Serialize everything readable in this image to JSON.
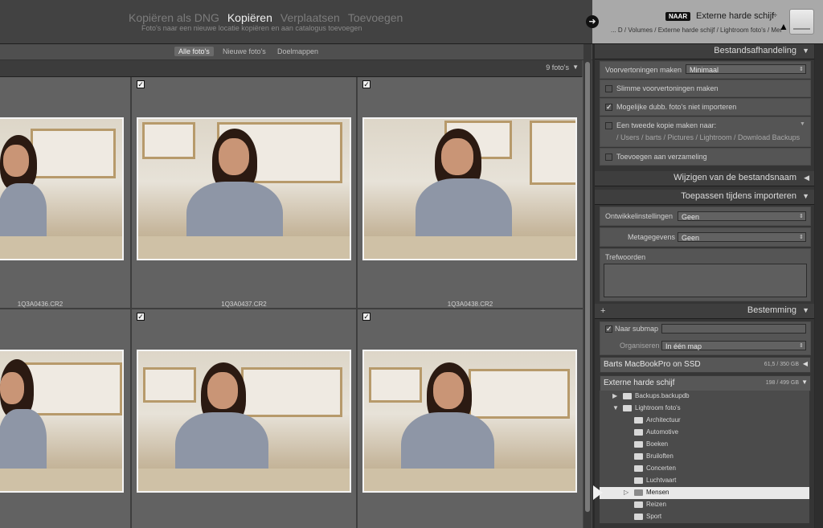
{
  "header": {
    "modes": [
      "Kopiëren als DNG",
      "Kopiëren",
      "Verplaatsen",
      "Toevoegen"
    ],
    "active_mode": "Kopiëren",
    "mode_description": "Foto's naar een nieuwe locatie kopiëren en aan catalogus toevoegen",
    "arrow_icon": "arrow-right-icon",
    "destination": {
      "badge": "NAAR",
      "name": "Externe harde schijf",
      "chevron": "÷",
      "path": "... D / Volumes / Externe harde schijf / Lightroom foto's / Mensen"
    }
  },
  "filters": [
    "Alle foto's",
    "Nieuwe foto's",
    "Doelmappen"
  ],
  "grid": {
    "count_label": "9 foto's",
    "count_tri": "▼",
    "photos": [
      {
        "filename": "1Q3A0436.CR2",
        "checked": true
      },
      {
        "filename": "1Q3A0437.CR2",
        "checked": true
      },
      {
        "filename": "1Q3A0438.CR2",
        "checked": true
      },
      {
        "filename": "",
        "checked": true
      },
      {
        "filename": "",
        "checked": true
      },
      {
        "filename": "",
        "checked": true
      }
    ]
  },
  "panel": {
    "file_handling": {
      "title": "Bestandsafhandeling",
      "preview_label": "Voorvertoningen maken",
      "preview_value": "Minimaal",
      "smart_previews": "Slimme voorvertoningen maken",
      "no_duplicates": "Mogelijke dubb. foto's niet importeren",
      "second_copy": "Een tweede kopie maken naar:",
      "second_copy_path": "/ Users / barts / Pictures / Lightroom / Download Backups",
      "add_collection": "Toevoegen aan verzameling"
    },
    "rename": {
      "title": "Wijzigen van de bestandsnaam"
    },
    "apply": {
      "title": "Toepassen tijdens importeren",
      "develop_label": "Ontwikkelinstellingen",
      "develop_value": "Geen",
      "metadata_label": "Metagegevens",
      "metadata_value": "Geen",
      "keywords_label": "Trefwoorden"
    },
    "destination": {
      "title": "Bestemming",
      "plus": "+",
      "subfolder_label": "Naar submap",
      "organize_label": "Organiseren",
      "organize_value": "In één map",
      "volumes": [
        {
          "name": "Barts MacBookPro on SSD",
          "size": "61,5 / 350 GB",
          "tri": "◀"
        },
        {
          "name": "Externe harde schijf",
          "size": "198 / 499 GB",
          "tri": "▼"
        }
      ],
      "folders": [
        {
          "label": "Backups.backupdb",
          "level": 1,
          "disclose": "▶"
        },
        {
          "label": "Lightroom foto's",
          "level": 1,
          "disclose": "▼"
        },
        {
          "label": "Architectuur",
          "level": 2,
          "disclose": ""
        },
        {
          "label": "Automotive",
          "level": 2,
          "disclose": ""
        },
        {
          "label": "Boeken",
          "level": 2,
          "disclose": ""
        },
        {
          "label": "Bruiloften",
          "level": 2,
          "disclose": ""
        },
        {
          "label": "Concerten",
          "level": 2,
          "disclose": ""
        },
        {
          "label": "Luchtvaart",
          "level": 2,
          "disclose": ""
        },
        {
          "label": "Mensen",
          "level": 2,
          "disclose": "▷",
          "selected": true
        },
        {
          "label": "Reizen",
          "level": 2,
          "disclose": ""
        },
        {
          "label": "Sport",
          "level": 2,
          "disclose": ""
        }
      ]
    },
    "tri_down": "▼",
    "tri_left": "◀",
    "check_mark": "✓",
    "select_arrows": "⇕"
  }
}
